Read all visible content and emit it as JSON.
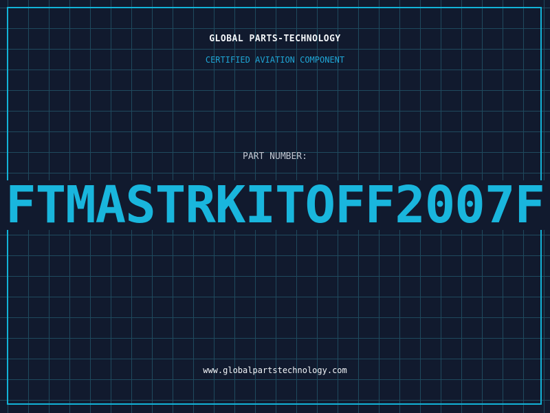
{
  "header": {
    "company_name": "GLOBAL PARTS-TECHNOLOGY",
    "tagline": "CERTIFIED AVIATION COMPONENT"
  },
  "part": {
    "label": "PART NUMBER:",
    "number": "FTMASTRKITOFF2007F"
  },
  "footer": {
    "website": "www.globalpartstechnology.com"
  },
  "colors": {
    "background": "#111a2e",
    "grid": "#1f4a5e",
    "accent": "#19b6dd",
    "text": "#f2f5f8"
  }
}
